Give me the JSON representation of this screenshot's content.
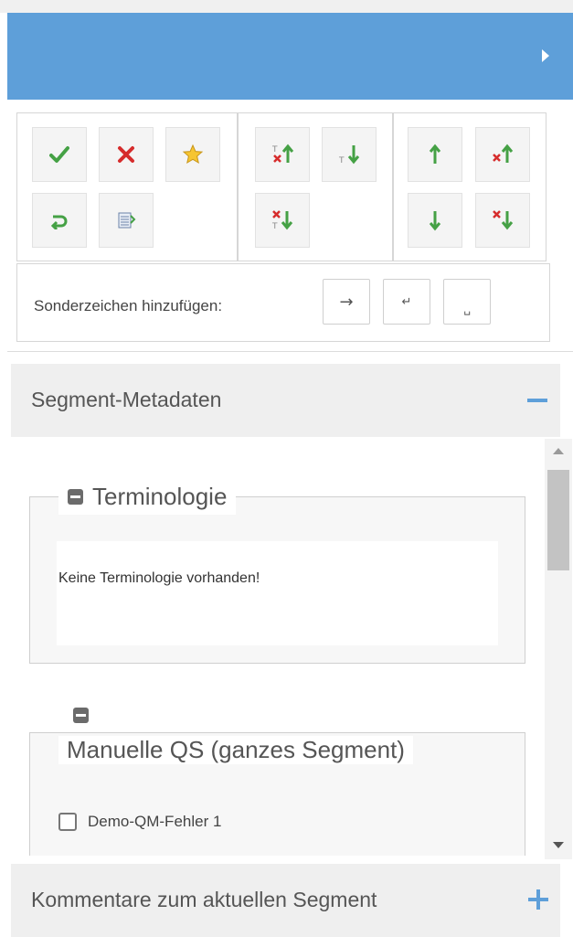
{
  "toolbar": {
    "groups": [
      {
        "name": "segment-actions",
        "buttons": [
          "save-check-icon",
          "cancel-x-icon",
          "star-icon",
          "reset-arrow-icon",
          "spreadsheet-icon"
        ]
      },
      {
        "name": "save-navigate",
        "buttons": [
          "save-go-prev-icon",
          "go-next-icon",
          "save-go-next-filtered-icon"
        ]
      },
      {
        "name": "navigate",
        "buttons": [
          "arrow-up-icon",
          "cancel-go-prev-icon",
          "arrow-down-icon",
          "cancel-go-next-icon"
        ]
      }
    ],
    "special_chars": {
      "label": "Sonderzeichen hinzufügen:",
      "buttons": [
        "→",
        "↵",
        "␣"
      ]
    }
  },
  "panels": {
    "metadata": {
      "title": "Segment-Metadaten",
      "terminology": {
        "legend": "Terminologie",
        "empty_text": "Keine Terminologie vorhanden!"
      },
      "manual_qs": {
        "legend": "Manuelle QS (ganzes Segment)",
        "items": [
          {
            "label": "Demo-QM-Fehler 1",
            "checked": false
          }
        ]
      }
    },
    "comments": {
      "title": "Kommentare zum aktuellen Segment"
    }
  },
  "colors": {
    "header": "#5e9fd9",
    "accent": "#5e9fd9",
    "button_green": "#45a145",
    "button_red": "#d62c2c"
  }
}
